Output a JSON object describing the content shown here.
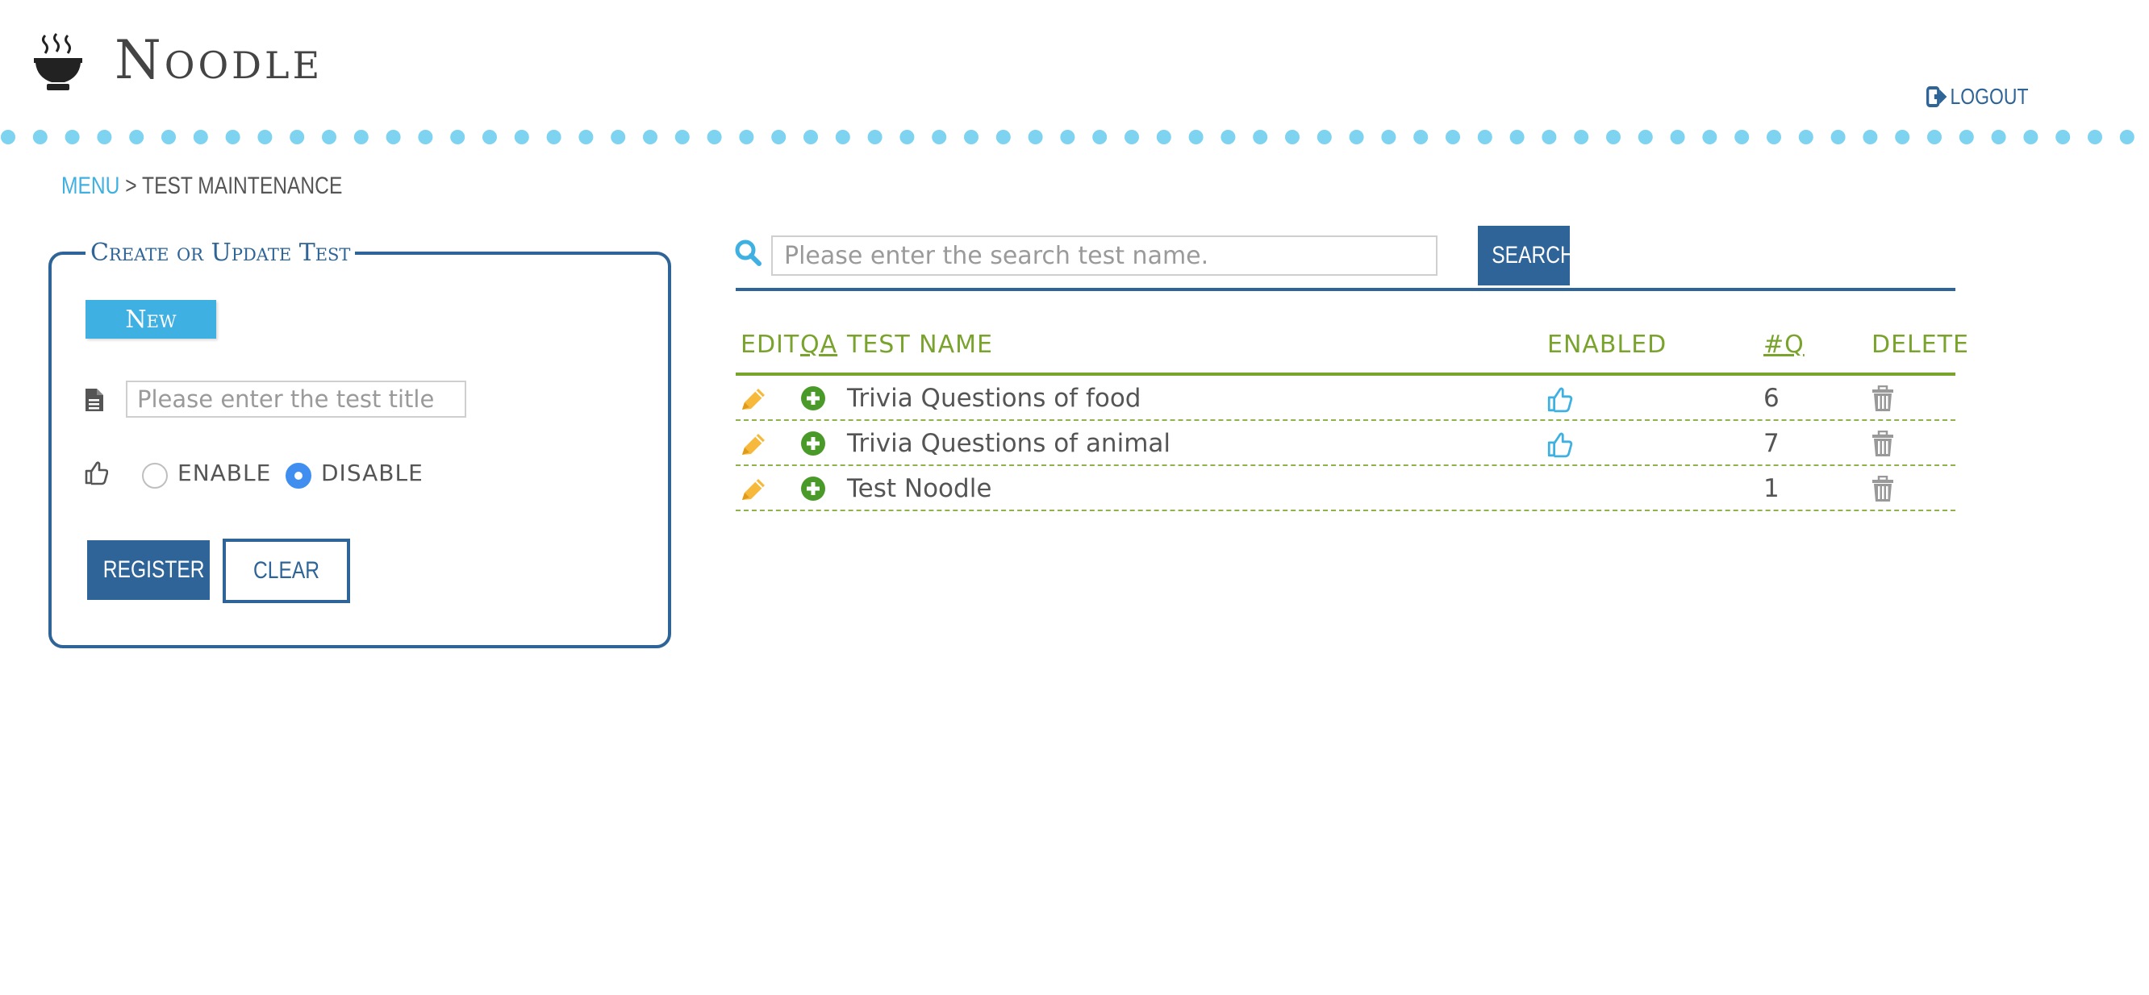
{
  "app": {
    "title": "Noodle",
    "logout_label": "LOGOUT"
  },
  "breadcrumb": {
    "menu_label": "MENU",
    "separator": ">",
    "current": "TEST MAINTENANCE"
  },
  "form": {
    "legend": "Create or Update Test",
    "new_button": "New",
    "title_placeholder": "Please enter the test title",
    "title_value": "",
    "enable_label": "ENABLE",
    "disable_label": "DISABLE",
    "selected_status": "DISABLE",
    "register_button": "REGISTER",
    "clear_button": "CLEAR"
  },
  "search": {
    "placeholder": "Please enter the search test name.",
    "value": "",
    "button_label": "SEARCH"
  },
  "table": {
    "columns": {
      "edit": "EDIT",
      "qa": "QA",
      "name": "TEST NAME",
      "enabled": "ENABLED",
      "count": "#Q",
      "delete": "DELETE"
    },
    "rows": [
      {
        "name": "Trivia Questions of food",
        "enabled": true,
        "questions": "6"
      },
      {
        "name": "Trivia Questions of animal",
        "enabled": true,
        "questions": "7"
      },
      {
        "name": "Test Noodle",
        "enabled": false,
        "questions": "1"
      }
    ]
  },
  "colors": {
    "primary": "#2e6497",
    "accent": "#3fb0e2",
    "green": "#7aa32e",
    "edit_icon": "#f6b93b",
    "qa_icon": "#4a9a2a",
    "dots": "#7dd3f0"
  },
  "icons": {
    "logo": "noodle-bowl-icon",
    "logout": "logout-icon",
    "search": "search-icon",
    "edit": "pencil-icon",
    "qa": "plus-circle-icon",
    "enabled": "thumbs-up-icon",
    "delete": "trash-icon"
  }
}
